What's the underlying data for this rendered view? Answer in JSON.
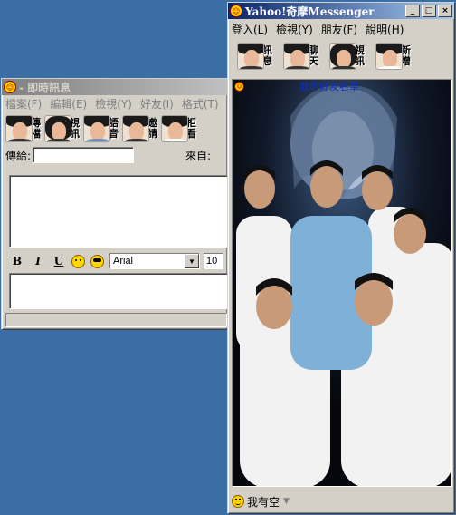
{
  "im_window": {
    "title": "- 即時訊息",
    "menu": [
      {
        "label": "檔案(F)"
      },
      {
        "label": "編輯(E)"
      },
      {
        "label": "檢視(Y)"
      },
      {
        "label": "好友(I)"
      },
      {
        "label": "格式(T)"
      }
    ],
    "toolbar": [
      {
        "l1": "傳",
        "l2": "檔"
      },
      {
        "l1": "視",
        "l2": "訊"
      },
      {
        "l1": "語",
        "l2": "音"
      },
      {
        "l1": "邀",
        "l2": "請"
      },
      {
        "l1": "拒",
        "l2": "看"
      }
    ],
    "to_label": "傳給:",
    "to_value": "",
    "from_label": "來自:",
    "format": {
      "bold": "B",
      "italic": "I",
      "underline": "U",
      "font": "Arial",
      "size": "10"
    }
  },
  "ym_window": {
    "title": "Yahoo!奇摩Messenger",
    "menu": [
      {
        "label": "登入(L)"
      },
      {
        "label": "檢視(Y)"
      },
      {
        "label": "朋友(F)"
      },
      {
        "label": "說明(H)"
      }
    ],
    "toolbar": [
      {
        "l1": "訊",
        "l2": "息"
      },
      {
        "l1": "聊",
        "l2": "天"
      },
      {
        "l1": "視",
        "l2": "訊"
      },
      {
        "l1": "新",
        "l2": "增"
      }
    ],
    "friends_label": "我的好友名單",
    "status": "我有空"
  },
  "colors": {
    "desktop": "#3a6ea5",
    "window_face": "#d4d0c8",
    "active_title": "#0a246a",
    "link_blue": "#1030c0"
  },
  "icons": [
    "yahoo-smiley-icon",
    "minimize-icon",
    "maximize-icon",
    "close-icon",
    "smiley-icon",
    "dropdown-arrow-icon"
  ]
}
